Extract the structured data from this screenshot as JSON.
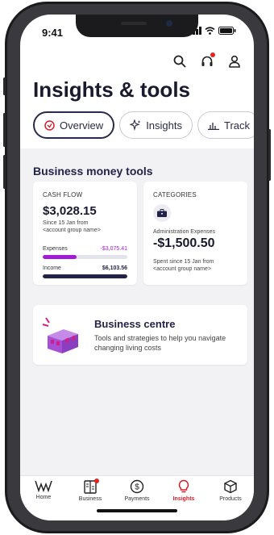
{
  "status": {
    "time": "9:41"
  },
  "page": {
    "title": "Insights & tools"
  },
  "tabs": [
    {
      "label": "Overview",
      "icon": "overview-icon"
    },
    {
      "label": "Insights",
      "icon": "sparkle-icon"
    },
    {
      "label": "Track",
      "icon": "chart-icon"
    }
  ],
  "section": {
    "title": "Business money tools"
  },
  "cash_flow": {
    "label": "CASH FLOW",
    "amount": "$3,028.15",
    "since": "Since 15 Jan from",
    "group": "<account group name>",
    "expenses_label": "Expenses",
    "expenses_value": "-$3,075.41",
    "expenses_fraction": 0.4,
    "income_label": "Income",
    "income_value": "$6,103.56",
    "income_fraction": 1.0
  },
  "categories": {
    "label": "CATEGORIES",
    "category": "Administration Expenses",
    "amount": "-$1,500.50",
    "spent_since": "Spent since 15 Jan from",
    "group": "<account group name>"
  },
  "business_centre": {
    "title": "Business centre",
    "subtitle": "Tools and strategies to help you navigate changing living costs"
  },
  "tabbar": [
    {
      "label": "Home",
      "icon": "home-icon"
    },
    {
      "label": "Business",
      "icon": "business-icon"
    },
    {
      "label": "Payments",
      "icon": "payments-icon"
    },
    {
      "label": "Insights",
      "icon": "lightbulb-icon",
      "active": true
    },
    {
      "label": "Products",
      "icon": "products-icon"
    }
  ],
  "colors": {
    "accent_red": "#d4202b",
    "expenses_purple": "#a31bd6",
    "income_navy": "#23234a"
  }
}
